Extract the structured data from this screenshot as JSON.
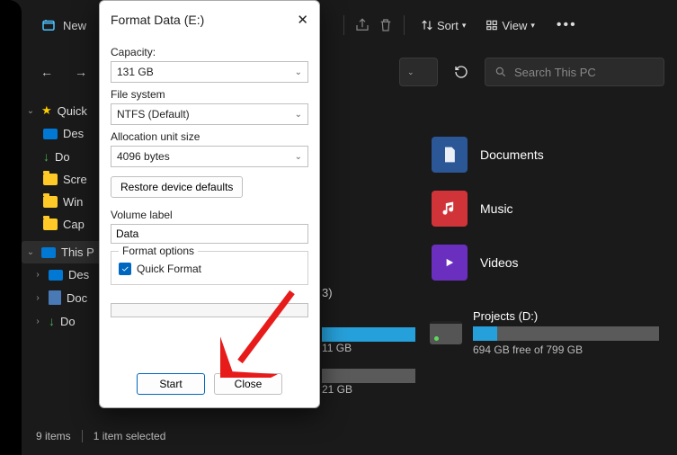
{
  "toolbar": {
    "new_label": "New",
    "sort_label": "Sort",
    "view_label": "View"
  },
  "nav": {
    "search_placeholder": "Search This PC"
  },
  "sidebar": {
    "quick": "Quick",
    "items": [
      "Des",
      "Do",
      "Scre",
      "Win",
      "Cap"
    ],
    "this_pc": "This P",
    "pc_items": [
      "Des",
      "Doc",
      "Do"
    ]
  },
  "libs": {
    "documents": "Documents",
    "music": "Music",
    "videos": "Videos"
  },
  "disks": {
    "left1_free": "11 GB",
    "left2_free": "21 GB",
    "right_name": "Projects (D:)",
    "right_free": "694 GB free of 799 GB",
    "group_count": "3)"
  },
  "status": {
    "items": "9 items",
    "selected": "1 item selected"
  },
  "dialog": {
    "title": "Format Data (E:)",
    "capacity_label": "Capacity:",
    "capacity_value": "131 GB",
    "fs_label": "File system",
    "fs_value": "NTFS (Default)",
    "au_label": "Allocation unit size",
    "au_value": "4096 bytes",
    "restore": "Restore device defaults",
    "vol_label": "Volume label",
    "vol_value": "Data",
    "options_label": "Format options",
    "quick_format": "Quick Format",
    "start": "Start",
    "close": "Close"
  }
}
